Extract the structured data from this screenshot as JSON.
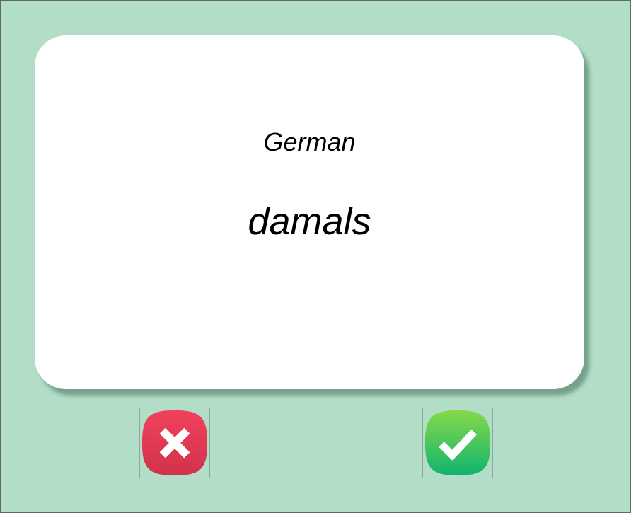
{
  "flashcard": {
    "language": "German",
    "word": "damals"
  },
  "buttons": {
    "wrong": {
      "icon": "cross-icon",
      "color_top": "#f0415f",
      "color_bottom": "#d2324a"
    },
    "right": {
      "icon": "checkmark-icon",
      "color_top": "#86d94a",
      "color_bottom": "#0fb46e"
    }
  }
}
